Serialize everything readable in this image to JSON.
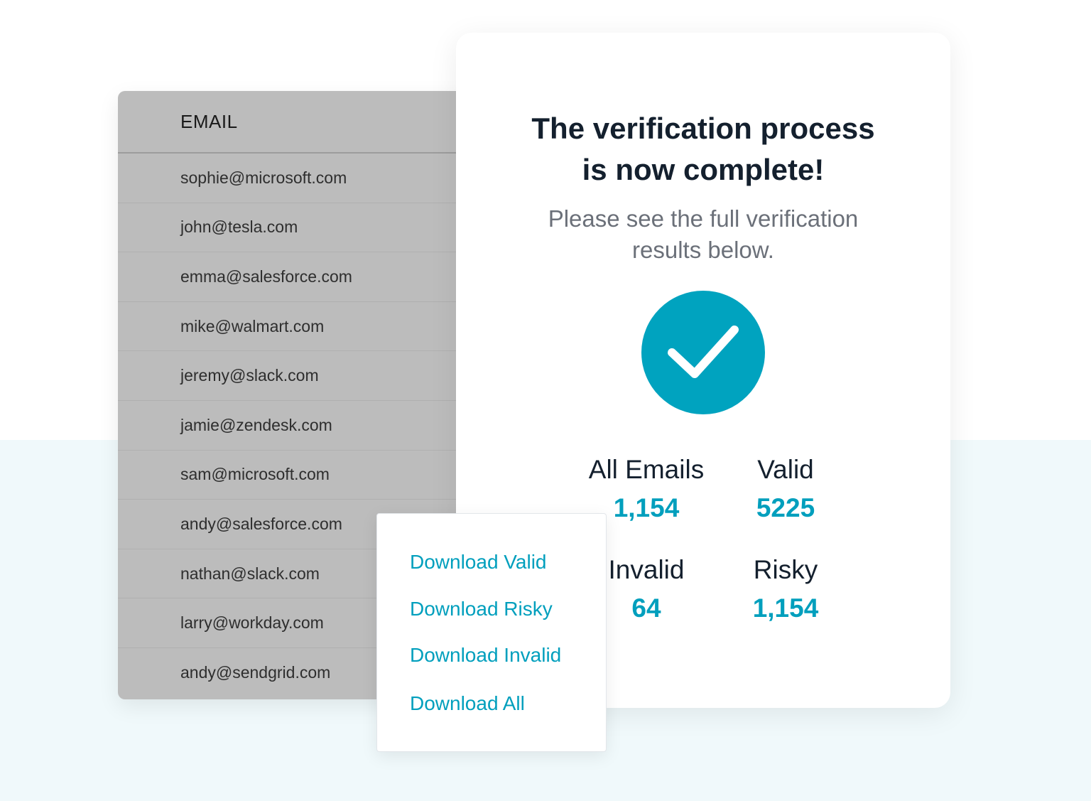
{
  "email_table": {
    "header": "EMAIL",
    "rows": [
      "sophie@microsoft.com",
      "john@tesla.com",
      "emma@salesforce.com",
      "mike@walmart.com",
      "jeremy@slack.com",
      "jamie@zendesk.com",
      "sam@microsoft.com",
      "andy@salesforce.com",
      "nathan@slack.com",
      "larry@workday.com",
      "andy@sendgrid.com"
    ]
  },
  "result": {
    "title_line1": "The verification process",
    "title_line2": "is now complete!",
    "subtitle_line1": "Please see the full verification",
    "subtitle_line2": "results below.",
    "check_icon": "check-icon",
    "stats": [
      {
        "label": "All Emails",
        "value": "1,154"
      },
      {
        "label": "Valid",
        "value": "5225"
      },
      {
        "label": "Invalid",
        "value": "64"
      },
      {
        "label": "Risky",
        "value": "1,154"
      }
    ]
  },
  "download_menu": {
    "items": [
      "Download Valid",
      "Download Risky",
      "Download Invalid",
      "Download All"
    ]
  },
  "colors": {
    "accent": "#00a3bf",
    "table_bg": "#bcbcbc",
    "bottom_bg": "#f0f9fb",
    "title_text": "#14202e"
  }
}
